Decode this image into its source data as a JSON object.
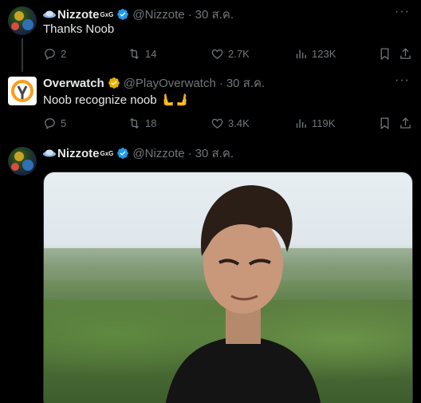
{
  "tweets": [
    {
      "author": {
        "name": "Nizzote",
        "name_suffix": "GxG",
        "handle": "@Nizzote",
        "verified_color": "#1d9bf0"
      },
      "separator": "·",
      "date": "30 ส.ค.",
      "text": "Thanks Noob",
      "stats": {
        "replies": "2",
        "retweets": "14",
        "likes": "2.7K",
        "views": "123K"
      }
    },
    {
      "author": {
        "name": "Overwatch",
        "handle": "@PlayOverwatch",
        "verified_color": "#e8b100"
      },
      "separator": "·",
      "date": "30 ส.ค.",
      "text": "Noob recognize noob",
      "emoji": "🫷🫸",
      "stats": {
        "replies": "5",
        "retweets": "18",
        "likes": "3.4K",
        "views": "119K"
      }
    },
    {
      "author": {
        "name": "Nizzote",
        "name_suffix": "GxG",
        "handle": "@Nizzote",
        "verified_color": "#1d9bf0"
      },
      "separator": "·",
      "date": "30 ส.ค."
    }
  ],
  "colors": {
    "background": "#000000",
    "text": "#e7e9ea",
    "muted": "#71767b",
    "verified_blue": "#1d9bf0",
    "verified_gold": "#e8b100",
    "overwatch_orange": "#f99e1a"
  },
  "icons": [
    "more-icon",
    "reply-icon",
    "retweet-icon",
    "like-icon",
    "views-icon",
    "bookmark-icon",
    "share-icon",
    "verified-badge-icon",
    "hat-icon"
  ]
}
